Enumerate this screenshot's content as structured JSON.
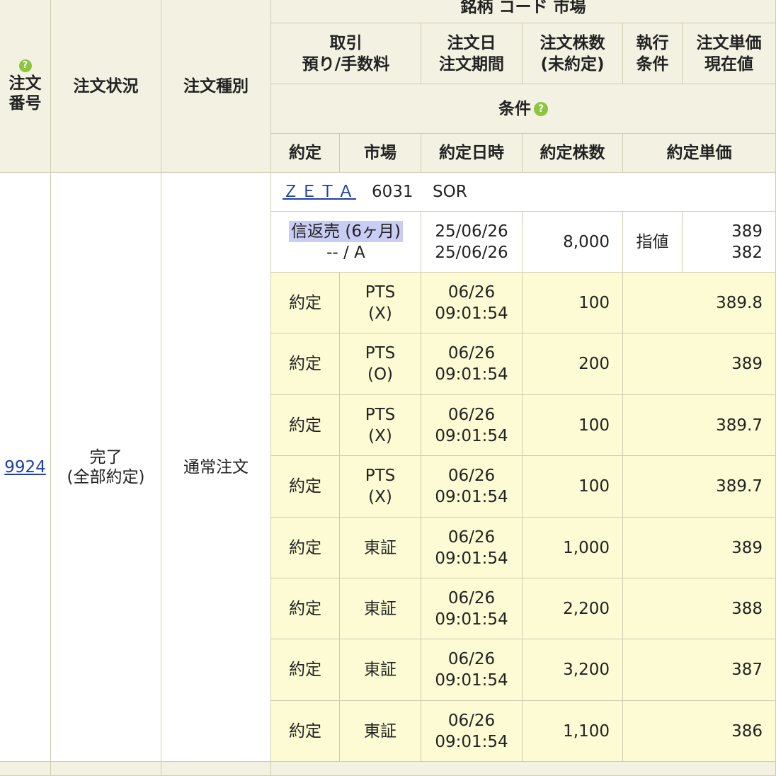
{
  "colors": {
    "header_bg": "#f3f1e2",
    "fill_bg": "#fcfbd3",
    "border": "#cfcdb0",
    "link": "#1f3fa6",
    "help_icon": "#8cc63f",
    "highlight": "#c9cdf3"
  },
  "header": {
    "order_no": [
      "注文",
      "番号"
    ],
    "status": "注文状況",
    "type": "注文種別",
    "stock_row": "銘柄 コード 市場",
    "trade": [
      "取引",
      "預り/手数料"
    ],
    "order_date": [
      "注文日",
      "注文期間"
    ],
    "shares": [
      "注文株数",
      "(未約定)"
    ],
    "exec_cond": [
      "執行",
      "条件"
    ],
    "price": [
      "注文単価",
      "現在値"
    ],
    "condition": "条件",
    "fill": "約定",
    "market": "市場",
    "fill_datetime": "約定日時",
    "fill_shares": "約定株数",
    "fill_price": "約定単価",
    "help_icon": "question-circle-icon",
    "help_glyph": "?"
  },
  "order": {
    "number": "9924",
    "status": [
      "完了",
      "(全部約定)"
    ],
    "type": "通常注文",
    "stock_name": "ＺＥＴＡ",
    "code": "6031",
    "market": "SOR",
    "trade": "信返売 (6ヶ月)",
    "fee": "-- / A",
    "order_date": "25/06/26",
    "period": "25/06/26",
    "shares": "8,000",
    "exec_cond": "指値",
    "price": "389",
    "current_price": "382"
  },
  "fills": [
    {
      "label": "約定",
      "market": [
        "PTS",
        "(X)"
      ],
      "date": "06/26",
      "time": "09:01:54",
      "shares": "100",
      "price": "389.8"
    },
    {
      "label": "約定",
      "market": [
        "PTS",
        "(O)"
      ],
      "date": "06/26",
      "time": "09:01:54",
      "shares": "200",
      "price": "389"
    },
    {
      "label": "約定",
      "market": [
        "PTS",
        "(X)"
      ],
      "date": "06/26",
      "time": "09:01:54",
      "shares": "100",
      "price": "389.7"
    },
    {
      "label": "約定",
      "market": [
        "PTS",
        "(X)"
      ],
      "date": "06/26",
      "time": "09:01:54",
      "shares": "100",
      "price": "389.7"
    },
    {
      "label": "約定",
      "market": [
        "東証"
      ],
      "date": "06/26",
      "time": "09:01:54",
      "shares": "1,000",
      "price": "389"
    },
    {
      "label": "約定",
      "market": [
        "東証"
      ],
      "date": "06/26",
      "time": "09:01:54",
      "shares": "2,200",
      "price": "388"
    },
    {
      "label": "約定",
      "market": [
        "東証"
      ],
      "date": "06/26",
      "time": "09:01:54",
      "shares": "3,200",
      "price": "387"
    },
    {
      "label": "約定",
      "market": [
        "東証"
      ],
      "date": "06/26",
      "time": "09:01:54",
      "shares": "1,100",
      "price": "386"
    }
  ]
}
